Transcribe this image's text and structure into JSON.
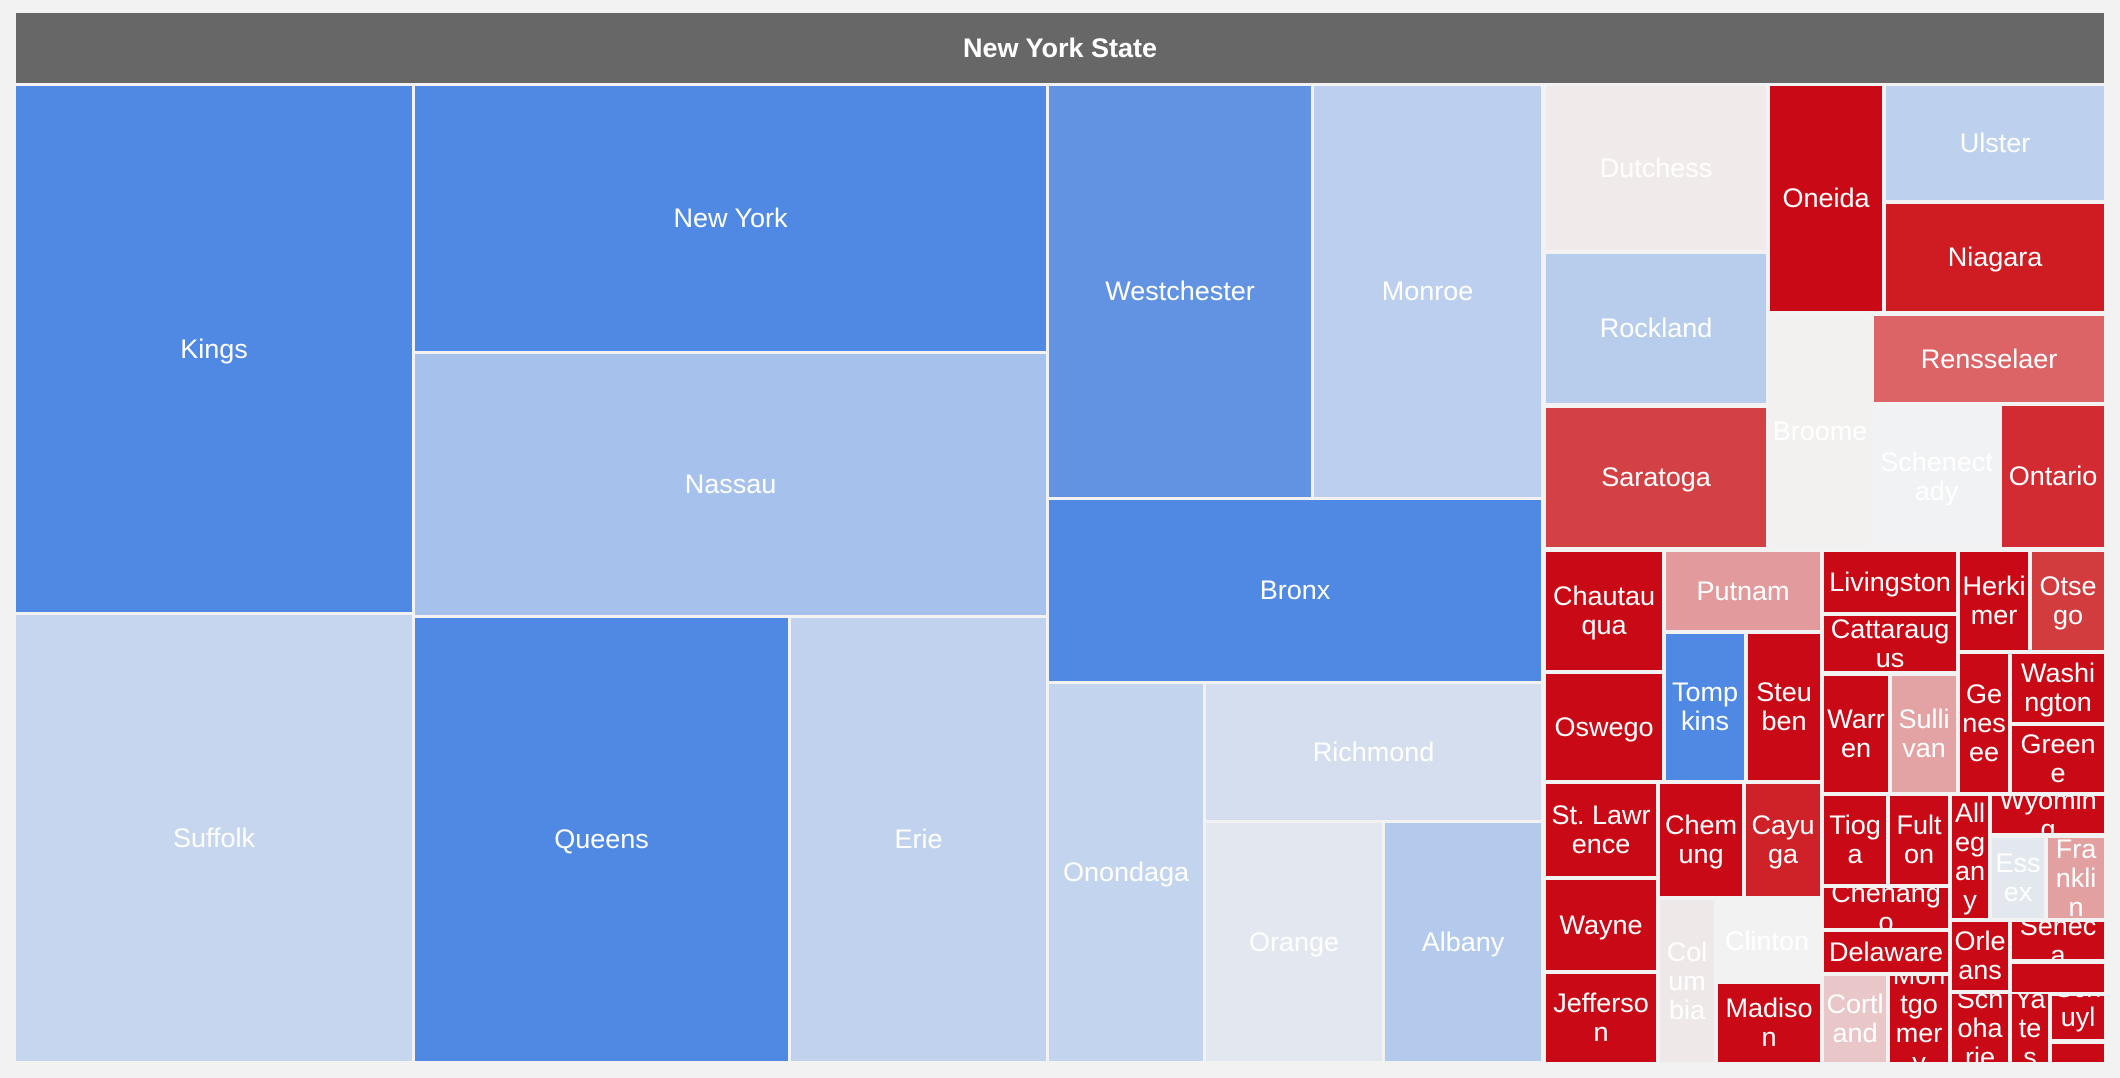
{
  "chart_data": {
    "type": "treemap",
    "title": "New York State",
    "items": [
      {
        "name": "Kings",
        "color": "#4f89e3"
      },
      {
        "name": "Suffolk",
        "color": "#c6d6ee"
      },
      {
        "name": "New York",
        "color": "#4f89e3"
      },
      {
        "name": "Nassau",
        "color": "#a6c2ec"
      },
      {
        "name": "Queens",
        "color": "#4f89e3"
      },
      {
        "name": "Erie",
        "color": "#c1d2ee"
      },
      {
        "name": "Westchester",
        "color": "#6193e2"
      },
      {
        "name": "Monroe",
        "color": "#bccfee"
      },
      {
        "name": "Bronx",
        "color": "#4f89e3"
      },
      {
        "name": "Onondaga",
        "color": "#c3d4ee"
      },
      {
        "name": "Richmond",
        "color": "#d4deee"
      },
      {
        "name": "Orange",
        "color": "#e3e7ef"
      },
      {
        "name": "Albany",
        "color": "#b4caec"
      },
      {
        "name": "Dutchess",
        "color": "#f0eaea"
      },
      {
        "name": "Rockland",
        "color": "#b8cdec"
      },
      {
        "name": "Saratoga",
        "color": "#d44144"
      },
      {
        "name": "Oneida",
        "color": "#c90915"
      },
      {
        "name": "Ulster",
        "color": "#bdd0ee"
      },
      {
        "name": "Niagara",
        "color": "#cf1c23"
      },
      {
        "name": "Broome",
        "color": "#f2f1f0"
      },
      {
        "name": "Rensselaer",
        "color": "#dc6366"
      },
      {
        "name": "Schenectady",
        "color": "#f1f2f3"
      },
      {
        "name": "Ontario",
        "color": "#d22b31"
      },
      {
        "name": "Chautauqua",
        "color": "#c90915"
      },
      {
        "name": "Putnam",
        "color": "#e39a9c"
      },
      {
        "name": "Tompkins",
        "color": "#4f89e3"
      },
      {
        "name": "Steuben",
        "color": "#c90915"
      },
      {
        "name": "Oswego",
        "color": "#c90915"
      },
      {
        "name": "St. Lawrence",
        "color": "#c90915"
      },
      {
        "name": "Chemung",
        "color": "#c90915"
      },
      {
        "name": "Cayuga",
        "color": "#cf2228"
      },
      {
        "name": "Wayne",
        "color": "#c90915"
      },
      {
        "name": "Jefferson",
        "color": "#c90915"
      },
      {
        "name": "Columbia",
        "color": "#efe8e8"
      },
      {
        "name": "Clinton",
        "color": "#f2f2f3"
      },
      {
        "name": "Madison",
        "color": "#c90915"
      },
      {
        "name": "Livingston",
        "color": "#c90915"
      },
      {
        "name": "Cattaraugus",
        "color": "#c90915"
      },
      {
        "name": "Warren",
        "color": "#c90915"
      },
      {
        "name": "Sullivan",
        "color": "#e3a2a3"
      },
      {
        "name": "Herkimer",
        "color": "#c90915"
      },
      {
        "name": "Otsego",
        "color": "#d23c3f"
      },
      {
        "name": "Genesee",
        "color": "#c90915"
      },
      {
        "name": "Washington",
        "color": "#c90915"
      },
      {
        "name": "Greene",
        "color": "#c90915"
      },
      {
        "name": "Tioga",
        "color": "#c90915"
      },
      {
        "name": "Fulton",
        "color": "#c90915"
      },
      {
        "name": "Chenango",
        "color": "#c90915"
      },
      {
        "name": "Delaware",
        "color": "#c90915"
      },
      {
        "name": "Cortland",
        "color": "#e9c6c7"
      },
      {
        "name": "Montgomery",
        "color": "#c90915"
      },
      {
        "name": "Allegany",
        "color": "#c90915"
      },
      {
        "name": "Wyoming",
        "color": "#c90915"
      },
      {
        "name": "Essex",
        "color": "#e3e8ef"
      },
      {
        "name": "Franklin",
        "color": "#e3a0a1"
      },
      {
        "name": "Orleans",
        "color": "#c90915"
      },
      {
        "name": "Seneca",
        "color": "#c90915"
      },
      {
        "name": "",
        "color": "#c90915"
      },
      {
        "name": "Schoharie",
        "color": "#c90915"
      },
      {
        "name": "Yates",
        "color": "#c90915"
      },
      {
        "name": "Schuyler",
        "color": "#c90915"
      },
      {
        "name": "",
        "color": "#c90915"
      }
    ]
  }
}
